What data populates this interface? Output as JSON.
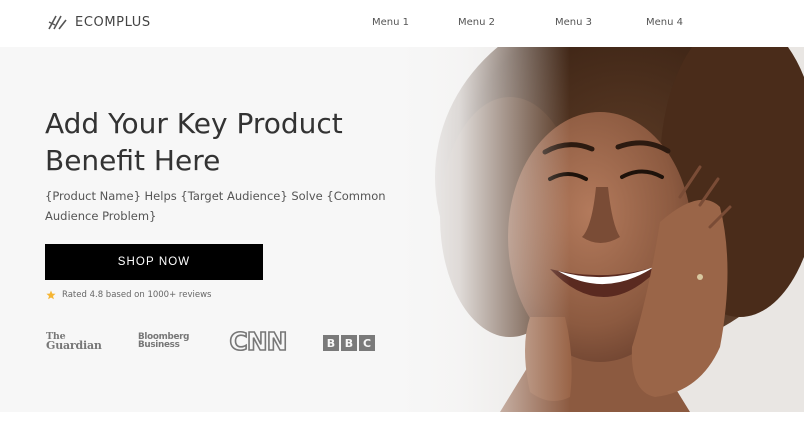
{
  "brand": {
    "name": "ECOMPLUS"
  },
  "nav": {
    "items": [
      "Menu 1",
      "Menu 2",
      "Menu 3",
      "Menu 4"
    ]
  },
  "hero": {
    "headline_line1": "Add Your Key Product",
    "headline_line2": "Benefit Here",
    "subtext_line1": "{Product Name} Helps {Target Audience} Solve {Common",
    "subtext_line2": "Audience Problem}",
    "cta_label": "SHOP NOW",
    "rating_text": "Rated 4.8 based on 1000+ reviews",
    "star_icon": "star-icon",
    "photo_icon": "portrait-photo"
  },
  "press": {
    "guardian_line1": "The",
    "guardian_line2": "Guardian",
    "bloomberg_line1": "Bloomberg",
    "bloomberg_line2": "Business",
    "cnn": "CNN",
    "bbc_letters": [
      "B",
      "B",
      "C"
    ]
  },
  "colors": {
    "cta_bg": "#000000",
    "hero_bg": "#f7f7f7",
    "star": "#f5b533",
    "press": "#777777"
  }
}
